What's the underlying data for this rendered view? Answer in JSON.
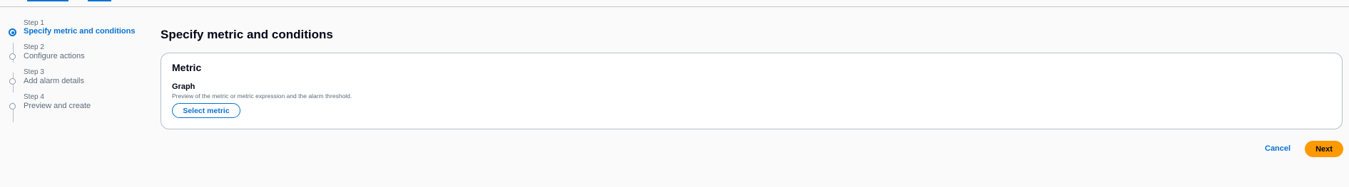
{
  "wizard": {
    "steps": [
      {
        "num": "Step 1",
        "label": "Specify metric and conditions",
        "active": true
      },
      {
        "num": "Step 2",
        "label": "Configure actions",
        "active": false
      },
      {
        "num": "Step 3",
        "label": "Add alarm details",
        "active": false
      },
      {
        "num": "Step 4",
        "label": "Preview and create",
        "active": false
      }
    ]
  },
  "main": {
    "title": "Specify metric and conditions",
    "metric_card": {
      "title": "Metric",
      "graph_label": "Graph",
      "graph_description": "Preview of the metric or metric expression and the alarm threshold.",
      "select_metric_label": "Select metric"
    }
  },
  "footer": {
    "cancel_label": "Cancel",
    "next_label": "Next"
  },
  "colors": {
    "accent": "#0972d3",
    "primary_button": "#ff9900",
    "background": "#fafafa"
  }
}
